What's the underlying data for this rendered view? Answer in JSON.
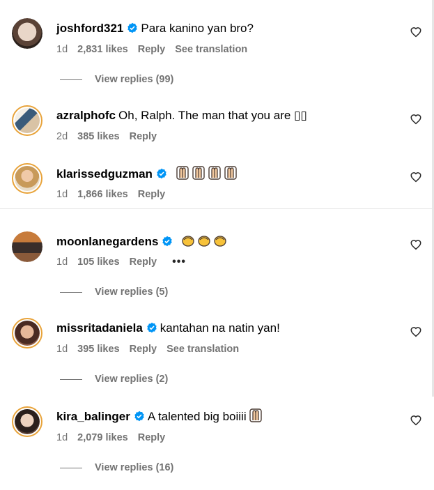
{
  "comments": [
    {
      "username": "joshford321",
      "verified": true,
      "text": "Para kanino yan bro?",
      "time": "1d",
      "likes": "2,831 likes",
      "reply": "Reply",
      "translation": "See translation",
      "view_replies": "View replies (99)"
    },
    {
      "username": "azralphofc",
      "verified": false,
      "text": "Oh, Ralph. The man that you are ▯▯",
      "time": "2d",
      "likes": "385 likes",
      "reply": "Reply"
    },
    {
      "username": "klarissedguzman",
      "verified": true,
      "text": "",
      "emoji": "pray-hands",
      "emoji_count": 4,
      "time": "1d",
      "likes": "1,866 likes",
      "reply": "Reply"
    },
    {
      "username": "moonlanegardens",
      "verified": true,
      "text": "",
      "emoji": "clapping-hands",
      "emoji_count": 3,
      "time": "1d",
      "likes": "105 likes",
      "reply": "Reply",
      "more": "•••",
      "view_replies": "View replies (5)"
    },
    {
      "username": "missritadaniela",
      "verified": true,
      "text": "kantahan na natin yan!",
      "time": "1d",
      "likes": "395 likes",
      "reply": "Reply",
      "translation": "See translation",
      "view_replies": "View replies (2)"
    },
    {
      "username": "kira_balinger",
      "verified": true,
      "text": "A talented big boiiii",
      "emoji": "pray-hands",
      "emoji_count": 1,
      "time": "1d",
      "likes": "2,079 likes",
      "reply": "Reply",
      "view_replies": "View replies (16)"
    }
  ],
  "colors": {
    "verified_blue": "#0095f6",
    "secondary_text": "#737373",
    "ring": "#e8a33a",
    "divider": "#e6e6e6"
  }
}
